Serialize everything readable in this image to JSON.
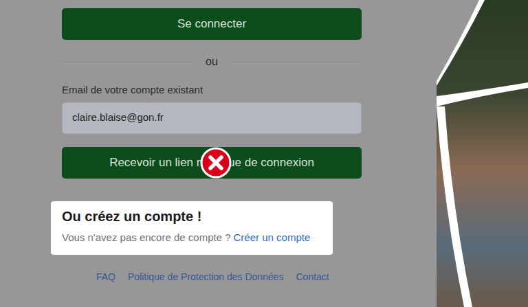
{
  "login_button": "Se connecter",
  "separator": "ou",
  "email": {
    "label": "Email de votre compte existant",
    "value": "claire.blaise@gon.fr"
  },
  "magic_link_button": "Recevoir un lien magique de connexion",
  "highlight": {
    "title": "Ou créez un compte !",
    "text": "Vous n'avez pas encore de compte ?",
    "link": "Créer un compte"
  },
  "footer_links": [
    "FAQ",
    "Politique de Protection des Données",
    "Contact"
  ]
}
